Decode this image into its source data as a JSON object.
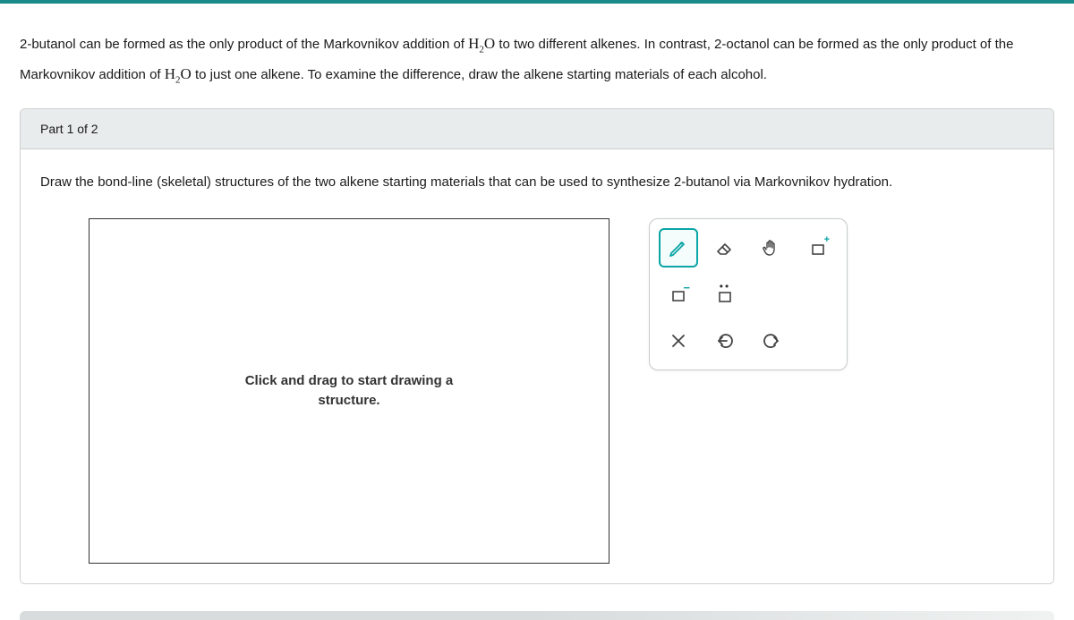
{
  "question": {
    "text_1a": "2-butanol can be formed as the only product of the Markovnikov addition of ",
    "chem1": "H",
    "chem1_sub": "2",
    "chem1_end": "O",
    "text_1b": " to two different alkenes. In contrast, 2-octanol can be formed as the only product of the Markovnikov addition of ",
    "chem2": "H",
    "chem2_sub": "2",
    "chem2_end": "O",
    "text_1c": " to just one alkene. To examine the difference, draw the alkene starting materials of each alcohol."
  },
  "part": {
    "header": "Part 1 of 2",
    "instruction": "Draw the bond-line (skeletal) structures of the two alkene starting materials that can be used to synthesize 2-butanol via Markovnikov hydration."
  },
  "canvas": {
    "hint_line1": "Click and drag to start drawing a",
    "hint_line2": "structure."
  },
  "tools": {
    "pencil": "pencil-icon",
    "eraser": "eraser-icon",
    "hand": "hand-icon",
    "charge_plus": "+",
    "charge_minus": "−",
    "lone_pair": "••",
    "clear": "clear-icon",
    "undo": "undo-icon",
    "redo": "redo-icon"
  }
}
